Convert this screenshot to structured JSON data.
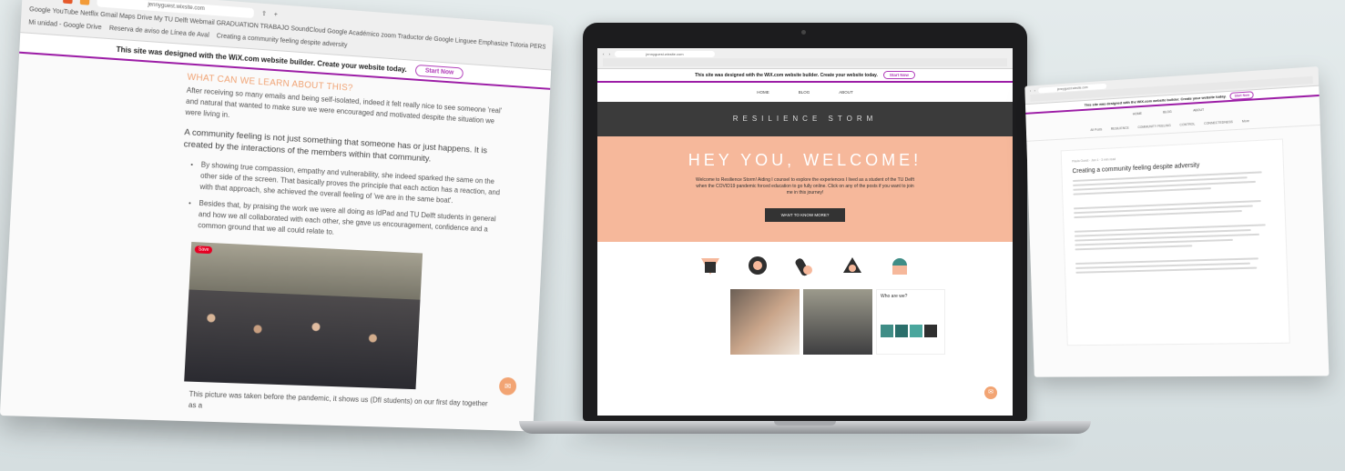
{
  "left_window": {
    "bookmarks": "Google  YouTube  Netflix  Gmail  Maps  Drive  My TU Delft Webmail  GRADUATION  TRABAJO  SoundCloud  Google Académico  zoom  Traductor de Google  Linguee  Emphasize  Tutoria  PERSONAL ZOOK  ESCORT",
    "url": "jennyguest.wixsite.com",
    "tab1": "Mi unidad - Google Drive",
    "tab2": "Reserva de aviso de Línea de Aval",
    "tab3": "Creating a community feeling despite adversity",
    "wix_message": "This site was designed with the WiX.com website builder. Create your website today.",
    "start_now": "Start Now",
    "heading": "WHAT CAN WE LEARN ABOUT THIS?",
    "para1": "After receiving so many emails and being self-isolated, indeed it felt really nice to see someone 'real' and natural that wanted to make sure we were encouraged and motivated despite the situation we were living in.",
    "para2": "A community feeling is not just something that someone has or just happens. It is created by the interactions of the members within that community.",
    "bullet1": "By showing true compassion, empathy and vulnerability, she indeed sparked the same on the other side of the screen. That basically proves the principle that each action has a reaction, and with that approach, she achieved the overall feeling of 'we are in the same boat'.",
    "bullet2": "Besides that, by praising the work we were all doing as IdPad and TU Delft students in general and how we all collaborated with each other, she gave us encouragement, confidence and a common ground that we all could relate to.",
    "save_badge": "Save",
    "caption": "This picture was taken before the pandemic, it shows us (DfI students) on our first day together as a"
  },
  "laptop_window": {
    "url": "jennyguest.wixsite.com",
    "wix_message": "This site was designed with the WiX.com website builder. Create your website today.",
    "start_now": "Start Now",
    "nav": [
      "HOME",
      "BLOG",
      "ABOUT"
    ],
    "site_title": "RESILIENCE STORM",
    "hero_title": "HEY YOU, WELCOME!",
    "hero_text": "Welcome to Resilience Storm! Aiding I counsel to explore the experiences I lived as a student of the TU Delft when the COVID19 pandemic forced education to go fully online. Click on any of the posts if you want to join me in this journey!",
    "hero_button": "WANT TO KNOW MORE?",
    "thumb_title": "Who are we?"
  },
  "right_window": {
    "url": "jennyguest.wixsite.com",
    "wix_message": "This site was designed with the WiX.com website builder. Create your website today.",
    "start_now": "Start Now",
    "nav": [
      "HOME",
      "BLOG",
      "ABOUT"
    ],
    "tabs": [
      "All Posts",
      "RESILIENCE",
      "COMMUNITY FEELING",
      "CONTROL",
      "CONNECTEDNESS",
      "More"
    ],
    "author": "Paula Guest · Jan 1 · 3 min read",
    "post_title": "Creating a community feeling despite adversity"
  },
  "colors": {
    "accent_purple": "#9c1da6",
    "peach": "#f6b89b",
    "orange_text": "#f0a374",
    "dark_band": "#3b3b3b"
  }
}
